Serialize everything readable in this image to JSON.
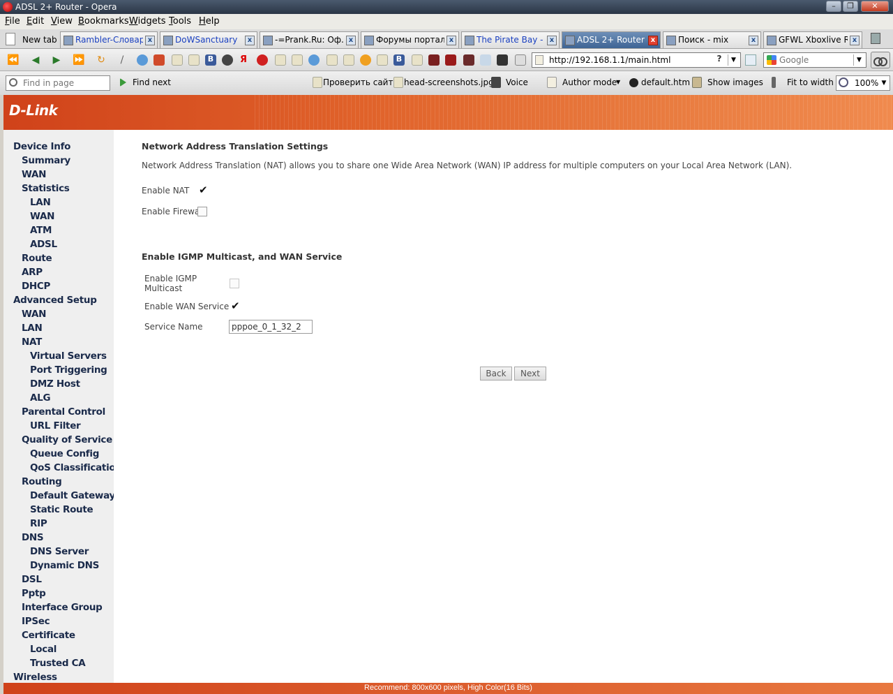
{
  "window": {
    "title": "ADSL 2+ Router - Opera"
  },
  "menu": [
    "File",
    "Edit",
    "View",
    "Bookmarks",
    "Widgets",
    "Tools",
    "Help"
  ],
  "tabs": {
    "new_tab": "New tab",
    "items": [
      {
        "label": "Rambler-Словари",
        "active": false
      },
      {
        "label": "DoWSanctuary",
        "active": false
      },
      {
        "label": "-=Prank.Ru: Оф...",
        "active": false
      },
      {
        "label": "Форумы портал...",
        "active": false
      },
      {
        "label": "The Pirate Bay - ...",
        "active": false
      },
      {
        "label": "ADSL 2+ Router",
        "active": true
      },
      {
        "label": "Поиск - mix",
        "active": false
      },
      {
        "label": "GFWL Xboxlive R...",
        "active": false
      }
    ]
  },
  "navbar": {
    "url": "http://192.168.1.1/main.html",
    "search_placeholder": "Google",
    "qmark": "?"
  },
  "findbar": {
    "find_placeholder": "Find in page",
    "find_next": "Find next",
    "check_site": "Проверить сайт!",
    "head_screenshots": "head-screenshots.jpg",
    "voice": "Voice",
    "author_mode": "Author mode",
    "default_htm": "default.htm",
    "show_images": "Show images",
    "fit_to_width": "Fit to width",
    "zoom": "100%"
  },
  "brand": {
    "logo": "D-Link"
  },
  "sidebar": {
    "items": [
      {
        "label": "Device Info",
        "level": 0
      },
      {
        "label": "Summary",
        "level": 1
      },
      {
        "label": "WAN",
        "level": 1
      },
      {
        "label": "Statistics",
        "level": 1
      },
      {
        "label": "LAN",
        "level": 2
      },
      {
        "label": "WAN",
        "level": 2
      },
      {
        "label": "ATM",
        "level": 2
      },
      {
        "label": "ADSL",
        "level": 2
      },
      {
        "label": "Route",
        "level": 1
      },
      {
        "label": "ARP",
        "level": 1
      },
      {
        "label": "DHCP",
        "level": 1
      },
      {
        "label": "Advanced Setup",
        "level": 0
      },
      {
        "label": "WAN",
        "level": 1
      },
      {
        "label": "LAN",
        "level": 1
      },
      {
        "label": "NAT",
        "level": 1
      },
      {
        "label": "Virtual Servers",
        "level": 2
      },
      {
        "label": "Port Triggering",
        "level": 2
      },
      {
        "label": "DMZ Host",
        "level": 2
      },
      {
        "label": "ALG",
        "level": 2
      },
      {
        "label": "Parental Control",
        "level": 1
      },
      {
        "label": "URL Filter",
        "level": 2
      },
      {
        "label": "Quality of Service",
        "level": 1
      },
      {
        "label": "Queue Config",
        "level": 2
      },
      {
        "label": "QoS Classification",
        "level": 2
      },
      {
        "label": "Routing",
        "level": 1
      },
      {
        "label": "Default Gateway",
        "level": 2
      },
      {
        "label": "Static Route",
        "level": 2
      },
      {
        "label": "RIP",
        "level": 2
      },
      {
        "label": "DNS",
        "level": 1
      },
      {
        "label": "DNS Server",
        "level": 2
      },
      {
        "label": "Dynamic DNS",
        "level": 2
      },
      {
        "label": "DSL",
        "level": 1
      },
      {
        "label": "Pptp",
        "level": 1
      },
      {
        "label": "Interface Group",
        "level": 1
      },
      {
        "label": "IPSec",
        "level": 1
      },
      {
        "label": "Certificate",
        "level": 1
      },
      {
        "label": "Local",
        "level": 2
      },
      {
        "label": "Trusted CA",
        "level": 2
      },
      {
        "label": "Wireless",
        "level": 0
      }
    ]
  },
  "content": {
    "nat_heading": "Network Address Translation Settings",
    "nat_description": "Network Address Translation (NAT) allows you to share one Wide Area Network (WAN) IP address for multiple computers on your Local Area Network (LAN).",
    "enable_nat_label": "Enable NAT",
    "enable_nat": true,
    "enable_firewall_label": "Enable Firewall",
    "enable_firewall": false,
    "igmp_heading": "Enable IGMP Multicast, and WAN Service",
    "enable_igmp_label_1": "Enable IGMP",
    "enable_igmp_label_2": "Multicast",
    "enable_igmp": false,
    "enable_wan_service_label": "Enable WAN Service",
    "enable_wan_service": true,
    "service_name_label": "Service Name",
    "service_name_value": "pppoe_0_1_32_2",
    "back_button": "Back",
    "next_button": "Next"
  },
  "footer": {
    "text": "Recommend: 800x600 pixels, High Color(16 Bits)"
  }
}
